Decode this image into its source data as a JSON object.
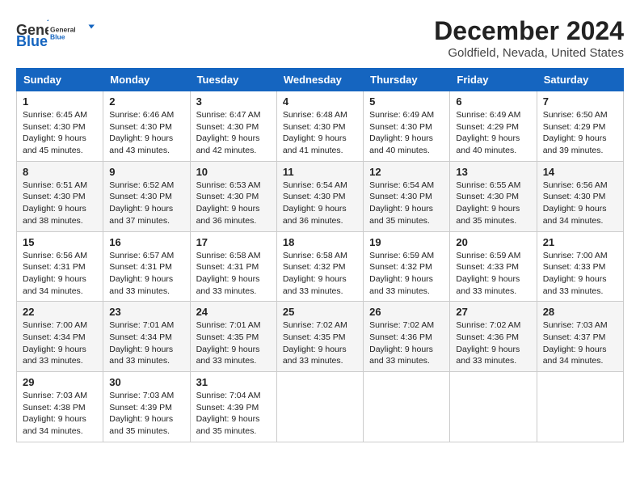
{
  "header": {
    "logo_general": "General",
    "logo_blue": "Blue",
    "title": "December 2024",
    "location": "Goldfield, Nevada, United States"
  },
  "columns": [
    "Sunday",
    "Monday",
    "Tuesday",
    "Wednesday",
    "Thursday",
    "Friday",
    "Saturday"
  ],
  "weeks": [
    [
      {
        "day": "1",
        "sunrise": "Sunrise: 6:45 AM",
        "sunset": "Sunset: 4:30 PM",
        "daylight": "Daylight: 9 hours and 45 minutes."
      },
      {
        "day": "2",
        "sunrise": "Sunrise: 6:46 AM",
        "sunset": "Sunset: 4:30 PM",
        "daylight": "Daylight: 9 hours and 43 minutes."
      },
      {
        "day": "3",
        "sunrise": "Sunrise: 6:47 AM",
        "sunset": "Sunset: 4:30 PM",
        "daylight": "Daylight: 9 hours and 42 minutes."
      },
      {
        "day": "4",
        "sunrise": "Sunrise: 6:48 AM",
        "sunset": "Sunset: 4:30 PM",
        "daylight": "Daylight: 9 hours and 41 minutes."
      },
      {
        "day": "5",
        "sunrise": "Sunrise: 6:49 AM",
        "sunset": "Sunset: 4:30 PM",
        "daylight": "Daylight: 9 hours and 40 minutes."
      },
      {
        "day": "6",
        "sunrise": "Sunrise: 6:49 AM",
        "sunset": "Sunset: 4:29 PM",
        "daylight": "Daylight: 9 hours and 40 minutes."
      },
      {
        "day": "7",
        "sunrise": "Sunrise: 6:50 AM",
        "sunset": "Sunset: 4:29 PM",
        "daylight": "Daylight: 9 hours and 39 minutes."
      }
    ],
    [
      {
        "day": "8",
        "sunrise": "Sunrise: 6:51 AM",
        "sunset": "Sunset: 4:30 PM",
        "daylight": "Daylight: 9 hours and 38 minutes."
      },
      {
        "day": "9",
        "sunrise": "Sunrise: 6:52 AM",
        "sunset": "Sunset: 4:30 PM",
        "daylight": "Daylight: 9 hours and 37 minutes."
      },
      {
        "day": "10",
        "sunrise": "Sunrise: 6:53 AM",
        "sunset": "Sunset: 4:30 PM",
        "daylight": "Daylight: 9 hours and 36 minutes."
      },
      {
        "day": "11",
        "sunrise": "Sunrise: 6:54 AM",
        "sunset": "Sunset: 4:30 PM",
        "daylight": "Daylight: 9 hours and 36 minutes."
      },
      {
        "day": "12",
        "sunrise": "Sunrise: 6:54 AM",
        "sunset": "Sunset: 4:30 PM",
        "daylight": "Daylight: 9 hours and 35 minutes."
      },
      {
        "day": "13",
        "sunrise": "Sunrise: 6:55 AM",
        "sunset": "Sunset: 4:30 PM",
        "daylight": "Daylight: 9 hours and 35 minutes."
      },
      {
        "day": "14",
        "sunrise": "Sunrise: 6:56 AM",
        "sunset": "Sunset: 4:30 PM",
        "daylight": "Daylight: 9 hours and 34 minutes."
      }
    ],
    [
      {
        "day": "15",
        "sunrise": "Sunrise: 6:56 AM",
        "sunset": "Sunset: 4:31 PM",
        "daylight": "Daylight: 9 hours and 34 minutes."
      },
      {
        "day": "16",
        "sunrise": "Sunrise: 6:57 AM",
        "sunset": "Sunset: 4:31 PM",
        "daylight": "Daylight: 9 hours and 33 minutes."
      },
      {
        "day": "17",
        "sunrise": "Sunrise: 6:58 AM",
        "sunset": "Sunset: 4:31 PM",
        "daylight": "Daylight: 9 hours and 33 minutes."
      },
      {
        "day": "18",
        "sunrise": "Sunrise: 6:58 AM",
        "sunset": "Sunset: 4:32 PM",
        "daylight": "Daylight: 9 hours and 33 minutes."
      },
      {
        "day": "19",
        "sunrise": "Sunrise: 6:59 AM",
        "sunset": "Sunset: 4:32 PM",
        "daylight": "Daylight: 9 hours and 33 minutes."
      },
      {
        "day": "20",
        "sunrise": "Sunrise: 6:59 AM",
        "sunset": "Sunset: 4:33 PM",
        "daylight": "Daylight: 9 hours and 33 minutes."
      },
      {
        "day": "21",
        "sunrise": "Sunrise: 7:00 AM",
        "sunset": "Sunset: 4:33 PM",
        "daylight": "Daylight: 9 hours and 33 minutes."
      }
    ],
    [
      {
        "day": "22",
        "sunrise": "Sunrise: 7:00 AM",
        "sunset": "Sunset: 4:34 PM",
        "daylight": "Daylight: 9 hours and 33 minutes."
      },
      {
        "day": "23",
        "sunrise": "Sunrise: 7:01 AM",
        "sunset": "Sunset: 4:34 PM",
        "daylight": "Daylight: 9 hours and 33 minutes."
      },
      {
        "day": "24",
        "sunrise": "Sunrise: 7:01 AM",
        "sunset": "Sunset: 4:35 PM",
        "daylight": "Daylight: 9 hours and 33 minutes."
      },
      {
        "day": "25",
        "sunrise": "Sunrise: 7:02 AM",
        "sunset": "Sunset: 4:35 PM",
        "daylight": "Daylight: 9 hours and 33 minutes."
      },
      {
        "day": "26",
        "sunrise": "Sunrise: 7:02 AM",
        "sunset": "Sunset: 4:36 PM",
        "daylight": "Daylight: 9 hours and 33 minutes."
      },
      {
        "day": "27",
        "sunrise": "Sunrise: 7:02 AM",
        "sunset": "Sunset: 4:36 PM",
        "daylight": "Daylight: 9 hours and 33 minutes."
      },
      {
        "day": "28",
        "sunrise": "Sunrise: 7:03 AM",
        "sunset": "Sunset: 4:37 PM",
        "daylight": "Daylight: 9 hours and 34 minutes."
      }
    ],
    [
      {
        "day": "29",
        "sunrise": "Sunrise: 7:03 AM",
        "sunset": "Sunset: 4:38 PM",
        "daylight": "Daylight: 9 hours and 34 minutes."
      },
      {
        "day": "30",
        "sunrise": "Sunrise: 7:03 AM",
        "sunset": "Sunset: 4:39 PM",
        "daylight": "Daylight: 9 hours and 35 minutes."
      },
      {
        "day": "31",
        "sunrise": "Sunrise: 7:04 AM",
        "sunset": "Sunset: 4:39 PM",
        "daylight": "Daylight: 9 hours and 35 minutes."
      },
      null,
      null,
      null,
      null
    ]
  ]
}
